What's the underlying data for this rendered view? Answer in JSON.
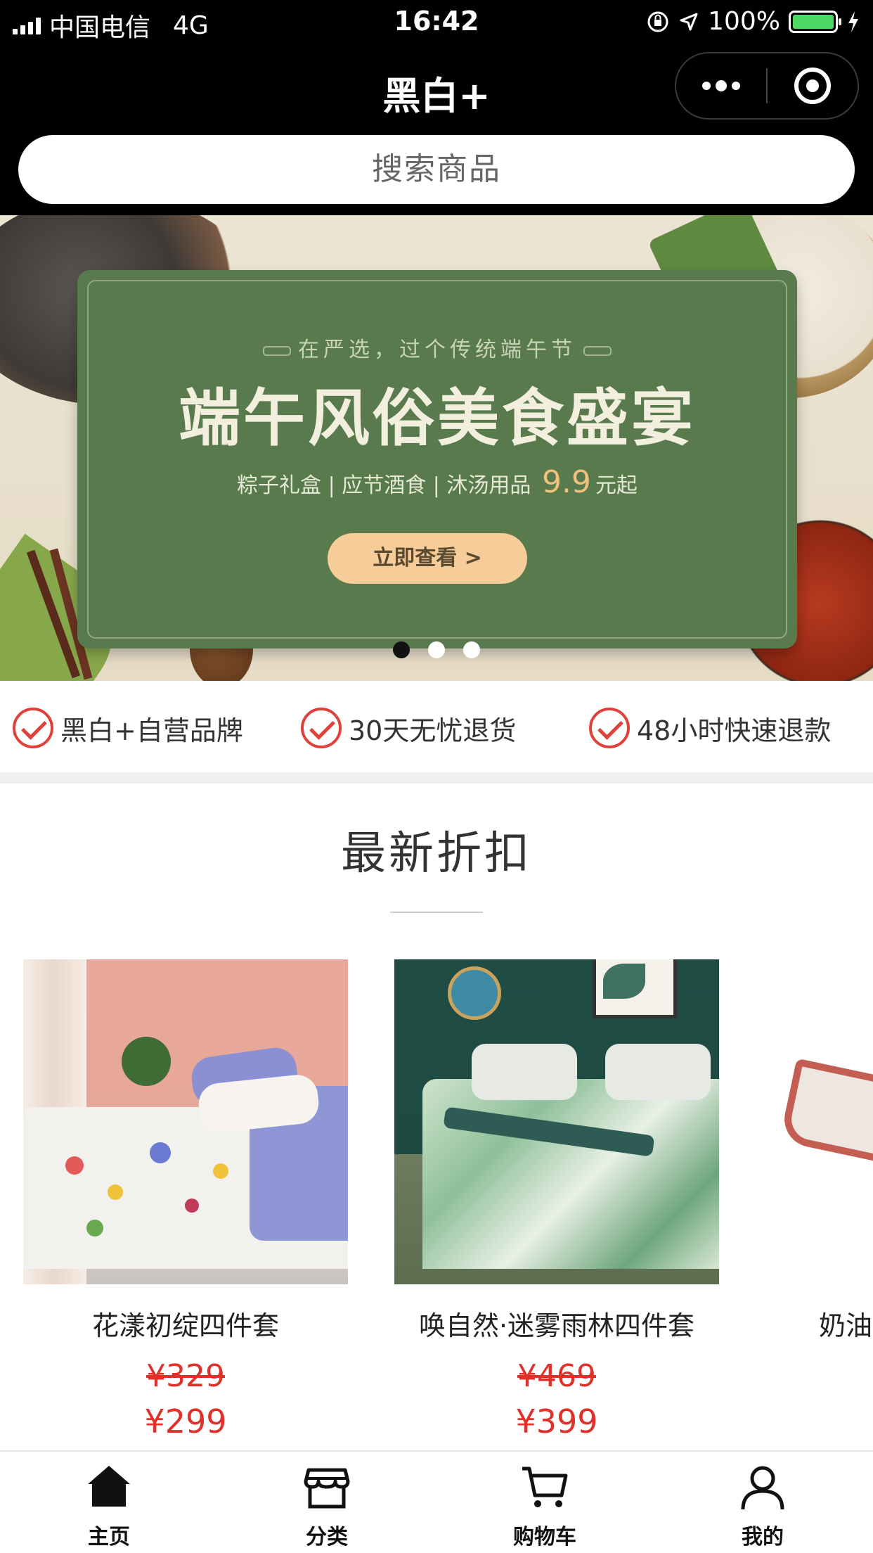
{
  "status_bar": {
    "carrier": "中国电信",
    "network": "4G",
    "time": "16:42",
    "battery": "100%"
  },
  "nav": {
    "title": "黑白+",
    "more_icon": "more-dots-icon",
    "close_icon": "target-circle-icon"
  },
  "search": {
    "placeholder": "搜索商品"
  },
  "banner": {
    "kicker": "在严选，过个传统端午节",
    "title": "端午风俗美食盛宴",
    "subtitle_prefix": "粽子礼盒 | 应节酒食 | 沐汤用品",
    "subtitle_price": "9.9",
    "subtitle_suffix": "元起",
    "cta": "立即查看 >",
    "slide_count": 3,
    "active_slide": 1
  },
  "guarantees": [
    {
      "icon": "check-circle-icon",
      "text": "黑白+自营品牌"
    },
    {
      "icon": "check-circle-icon",
      "text": "30天无忧退货"
    },
    {
      "icon": "check-circle-icon",
      "text": "48小时快速退款"
    }
  ],
  "section": {
    "title": "最新折扣"
  },
  "products": [
    {
      "name": "花漾初绽四件套",
      "original_price": "¥329",
      "price": "¥299"
    },
    {
      "name": "唤自然·迷雾雨林四件套",
      "original_price": "¥469",
      "price": "¥399"
    },
    {
      "name": "奶油",
      "original_price": "",
      "price": ""
    }
  ],
  "tabbar": [
    {
      "label": "主页",
      "icon": "home-icon",
      "active": true
    },
    {
      "label": "分类",
      "icon": "store-icon",
      "active": false
    },
    {
      "label": "购物车",
      "icon": "cart-icon",
      "active": false
    },
    {
      "label": "我的",
      "icon": "user-icon",
      "active": false
    }
  ],
  "colors": {
    "accent_red": "#e0302a",
    "banner_green": "#587a4c",
    "cta": "#f6cc98"
  }
}
